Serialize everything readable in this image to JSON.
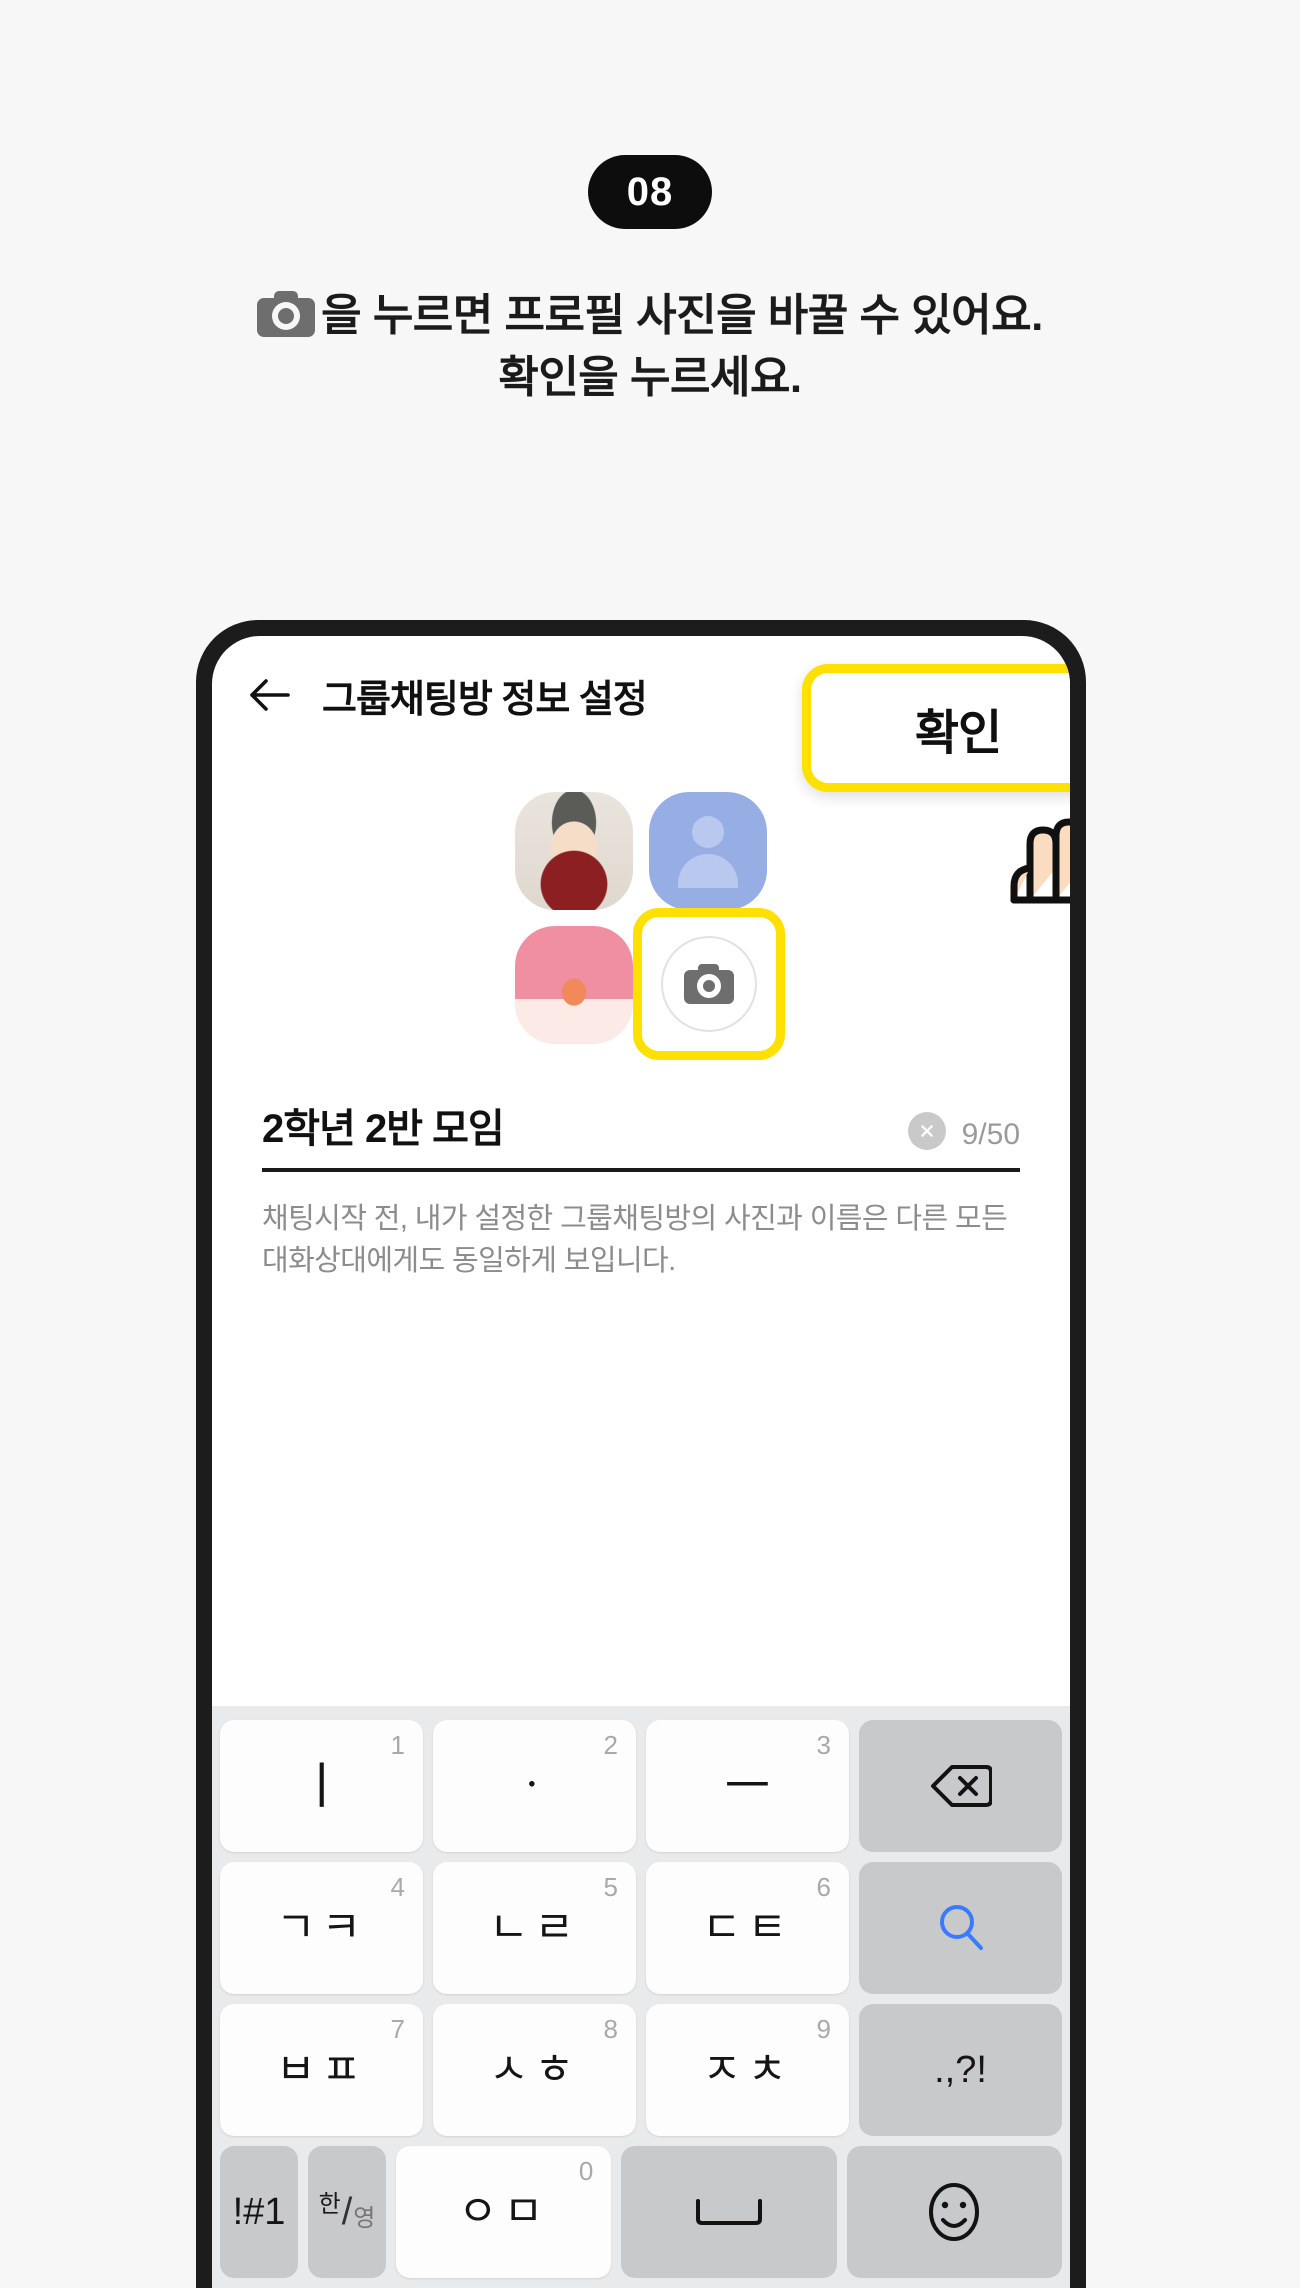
{
  "step": {
    "badge": "08"
  },
  "instructions": {
    "camera_icon": "camera-icon",
    "line1": "을 누르면 프로필 사진을 바꿀 수 있어요.",
    "line2": "확인을 누르세요."
  },
  "phone": {
    "appbar": {
      "back_icon": "back-arrow-icon",
      "title": "그룹채팅방 정보 설정",
      "confirm_label": "확인"
    },
    "avatars": [
      {
        "name": "avatar-child-photo",
        "kind": "photo"
      },
      {
        "name": "avatar-default-person",
        "kind": "placeholder"
      },
      {
        "name": "avatar-drink-photo",
        "kind": "photo"
      },
      {
        "name": "avatar-sea-photo",
        "kind": "photo"
      }
    ],
    "camera_button": {
      "icon": "camera-icon"
    },
    "name_field": {
      "value": "2학년 2반 모임",
      "counter": "9/50",
      "clear_icon": "clear-x-icon"
    },
    "helper_text": "채팅시작 전, 내가 설정한 그룹채팅방의 사진과 이름은 다른 모든 대화상대에게도 동일하게 보입니다."
  },
  "keyboard": {
    "rows": [
      [
        {
          "glyph": "ㅣ",
          "num": "1",
          "type": "char"
        },
        {
          "glyph": "ㆍ",
          "num": "2",
          "type": "char"
        },
        {
          "glyph": "ㅡ",
          "num": "3",
          "type": "char"
        },
        {
          "glyph": "backspace-icon",
          "num": "",
          "type": "fn"
        }
      ],
      [
        {
          "glyph": "ㄱㅋ",
          "num": "4",
          "type": "char"
        },
        {
          "glyph": "ㄴㄹ",
          "num": "5",
          "type": "char"
        },
        {
          "glyph": "ㄷㅌ",
          "num": "6",
          "type": "char"
        },
        {
          "glyph": "search-icon",
          "num": "",
          "type": "fn"
        }
      ],
      [
        {
          "glyph": "ㅂㅍ",
          "num": "7",
          "type": "char"
        },
        {
          "glyph": "ㅅㅎ",
          "num": "8",
          "type": "char"
        },
        {
          "glyph": "ㅈㅊ",
          "num": "9",
          "type": "char"
        },
        {
          "glyph": ".,?!",
          "num": "",
          "type": "fn"
        }
      ],
      [
        {
          "glyph": "!#1",
          "num": "",
          "type": "fn"
        },
        {
          "glyph": "한/영",
          "num": "",
          "type": "fn"
        },
        {
          "glyph": "ㅇㅁ",
          "num": "0",
          "type": "char"
        },
        {
          "glyph": "space-icon",
          "num": "",
          "type": "fn"
        },
        {
          "glyph": "emoji-icon",
          "num": "",
          "type": "fn"
        }
      ]
    ],
    "han_label": "한",
    "eng_label": "영"
  },
  "colors": {
    "highlight": "#ffe000",
    "background": "#f7f7f7",
    "badge": "#0d0d0d",
    "search_blue": "#3a7afe"
  }
}
